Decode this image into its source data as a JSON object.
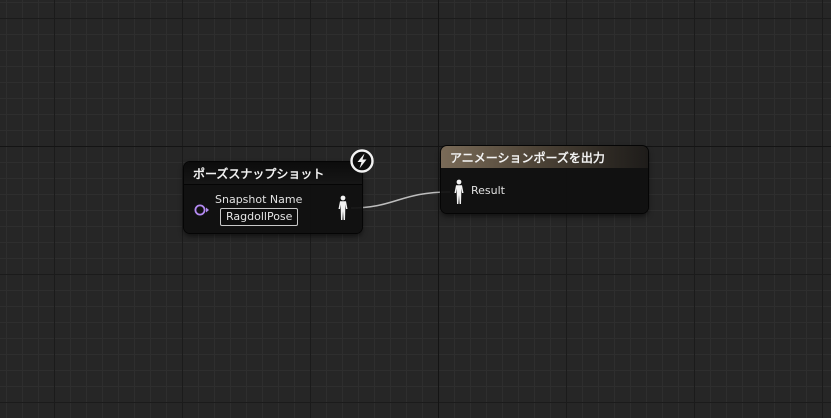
{
  "graph": {
    "nodes": {
      "pose_snapshot": {
        "title": "ポーズスナップショット",
        "input_pin_label": "Snapshot Name",
        "input_value": "RagdollPose",
        "badge_icon": "lightning-bolt-icon",
        "input_pin_color": "#b48af2",
        "output_pin_icon": "pose-figure-icon"
      },
      "output_pose": {
        "title": "アニメーションポーズを出力",
        "input_pin_label": "Result",
        "header_color": "#7a6b58",
        "input_pin_icon": "pose-figure-icon"
      }
    },
    "wire_color": "#bdbdbd"
  }
}
